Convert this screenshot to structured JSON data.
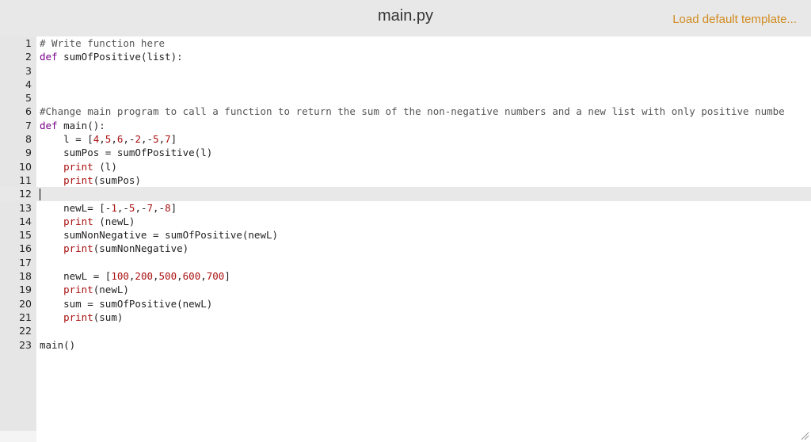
{
  "header": {
    "title": "main.py",
    "load_link": "Load default template...",
    "accent_color": "#d18b1f"
  },
  "editor": {
    "active_line": 12,
    "cursor_line": 12,
    "lines": [
      {
        "n": "1",
        "code": "# Write function here"
      },
      {
        "n": "2",
        "code": "def sumOfPositive(list):"
      },
      {
        "n": "3",
        "code": ""
      },
      {
        "n": "4",
        "code": ""
      },
      {
        "n": "5",
        "code": ""
      },
      {
        "n": "6",
        "code": "#Change main program to call a function to return the sum of the non-negative numbers and a new list with only positive numbe"
      },
      {
        "n": "7",
        "code": "def main():"
      },
      {
        "n": "8",
        "code": "    l = [4,5,6,-2,-5,7]"
      },
      {
        "n": "9",
        "code": "    sumPos = sumOfPositive(l)"
      },
      {
        "n": "10",
        "code": "    print (l)"
      },
      {
        "n": "11",
        "code": "    print(sumPos)"
      },
      {
        "n": "12",
        "code": ""
      },
      {
        "n": "13",
        "code": "    newL= [-1,-5,-7,-8]"
      },
      {
        "n": "14",
        "code": "    print (newL)"
      },
      {
        "n": "15",
        "code": "    sumNonNegative = sumOfPositive(newL)"
      },
      {
        "n": "16",
        "code": "    print(sumNonNegative)"
      },
      {
        "n": "17",
        "code": ""
      },
      {
        "n": "18",
        "code": "    newL = [100,200,500,600,700]"
      },
      {
        "n": "19",
        "code": "    print(newL)"
      },
      {
        "n": "20",
        "code": "    sum = sumOfPositive(newL)"
      },
      {
        "n": "21",
        "code": "    print(sum)"
      },
      {
        "n": "22",
        "code": ""
      },
      {
        "n": "23",
        "code": "main()"
      }
    ]
  },
  "icons": {
    "resize": "resize-handle-icon"
  }
}
